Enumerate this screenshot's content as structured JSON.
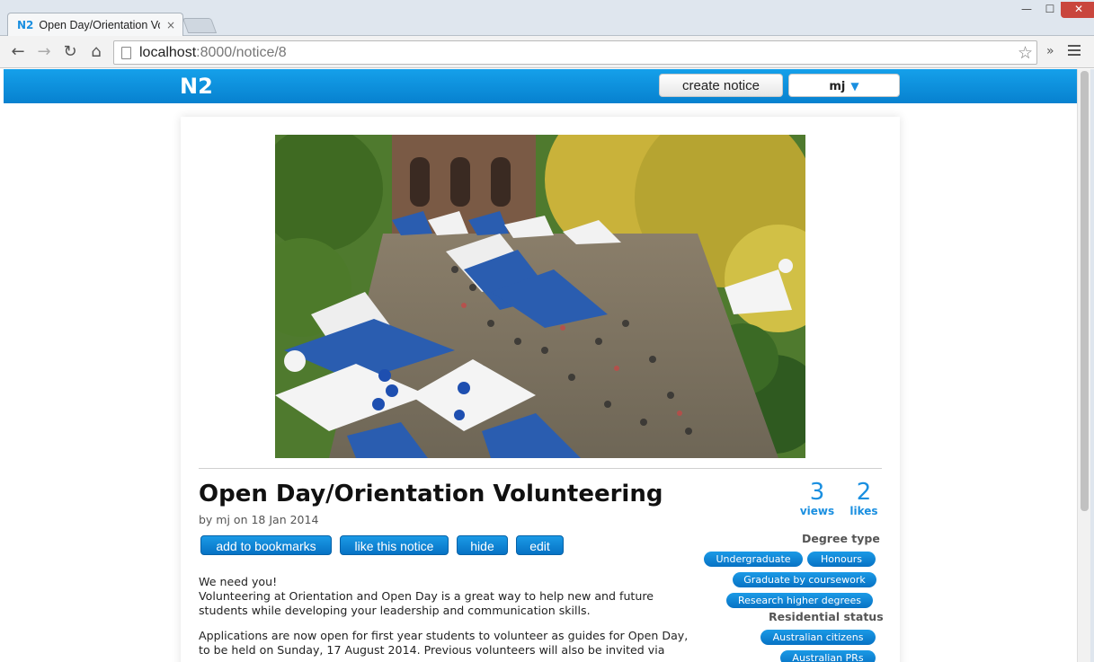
{
  "browser": {
    "tab_favicon": "N2",
    "tab_title": "Open Day/Orientation Vol",
    "tab_close": "×",
    "url_host": "localhost",
    "url_path": ":8000/notice/8",
    "icons": [
      "back-icon",
      "forward-icon",
      "reload-icon",
      "home-icon",
      "bookmark-star-icon",
      "extensions-chevron-icon",
      "menu-icon"
    ]
  },
  "appbar": {
    "logo": "N2",
    "create_label": "create notice",
    "user_label": "mj",
    "user_caret": "▼"
  },
  "notice": {
    "title": "Open Day/Orientation Volunteering",
    "byline": "by mj on 18 Jan 2014",
    "actions": {
      "bookmark": "add to bookmarks",
      "like": "like this notice",
      "hide": "hide",
      "edit": "edit"
    },
    "stats": {
      "views": "3",
      "views_label": "views",
      "likes": "2",
      "likes_label": "likes"
    },
    "body": {
      "p1_line1": "We need you!",
      "p1_line2": "Volunteering at Orientation and Open Day is a great way to help new and future students while developing your leadership and communication skills.",
      "p2": "Applications are now open for first year students to volunteer as guides for Open Day, to be held on Sunday, 17 August 2014. Previous volunteers will also be invited via"
    },
    "tags": {
      "degree_heading": "Degree type",
      "undergraduate": "Undergraduate",
      "honours": "Honours",
      "coursework": "Graduate by coursework",
      "research": "Research higher degrees",
      "residential_heading": "Residential status",
      "citizens": "Australian citizens",
      "prs": "Australian PRs"
    }
  },
  "colors": {
    "accent": "#1a8fe0",
    "appbar": "#0a8ad8"
  }
}
